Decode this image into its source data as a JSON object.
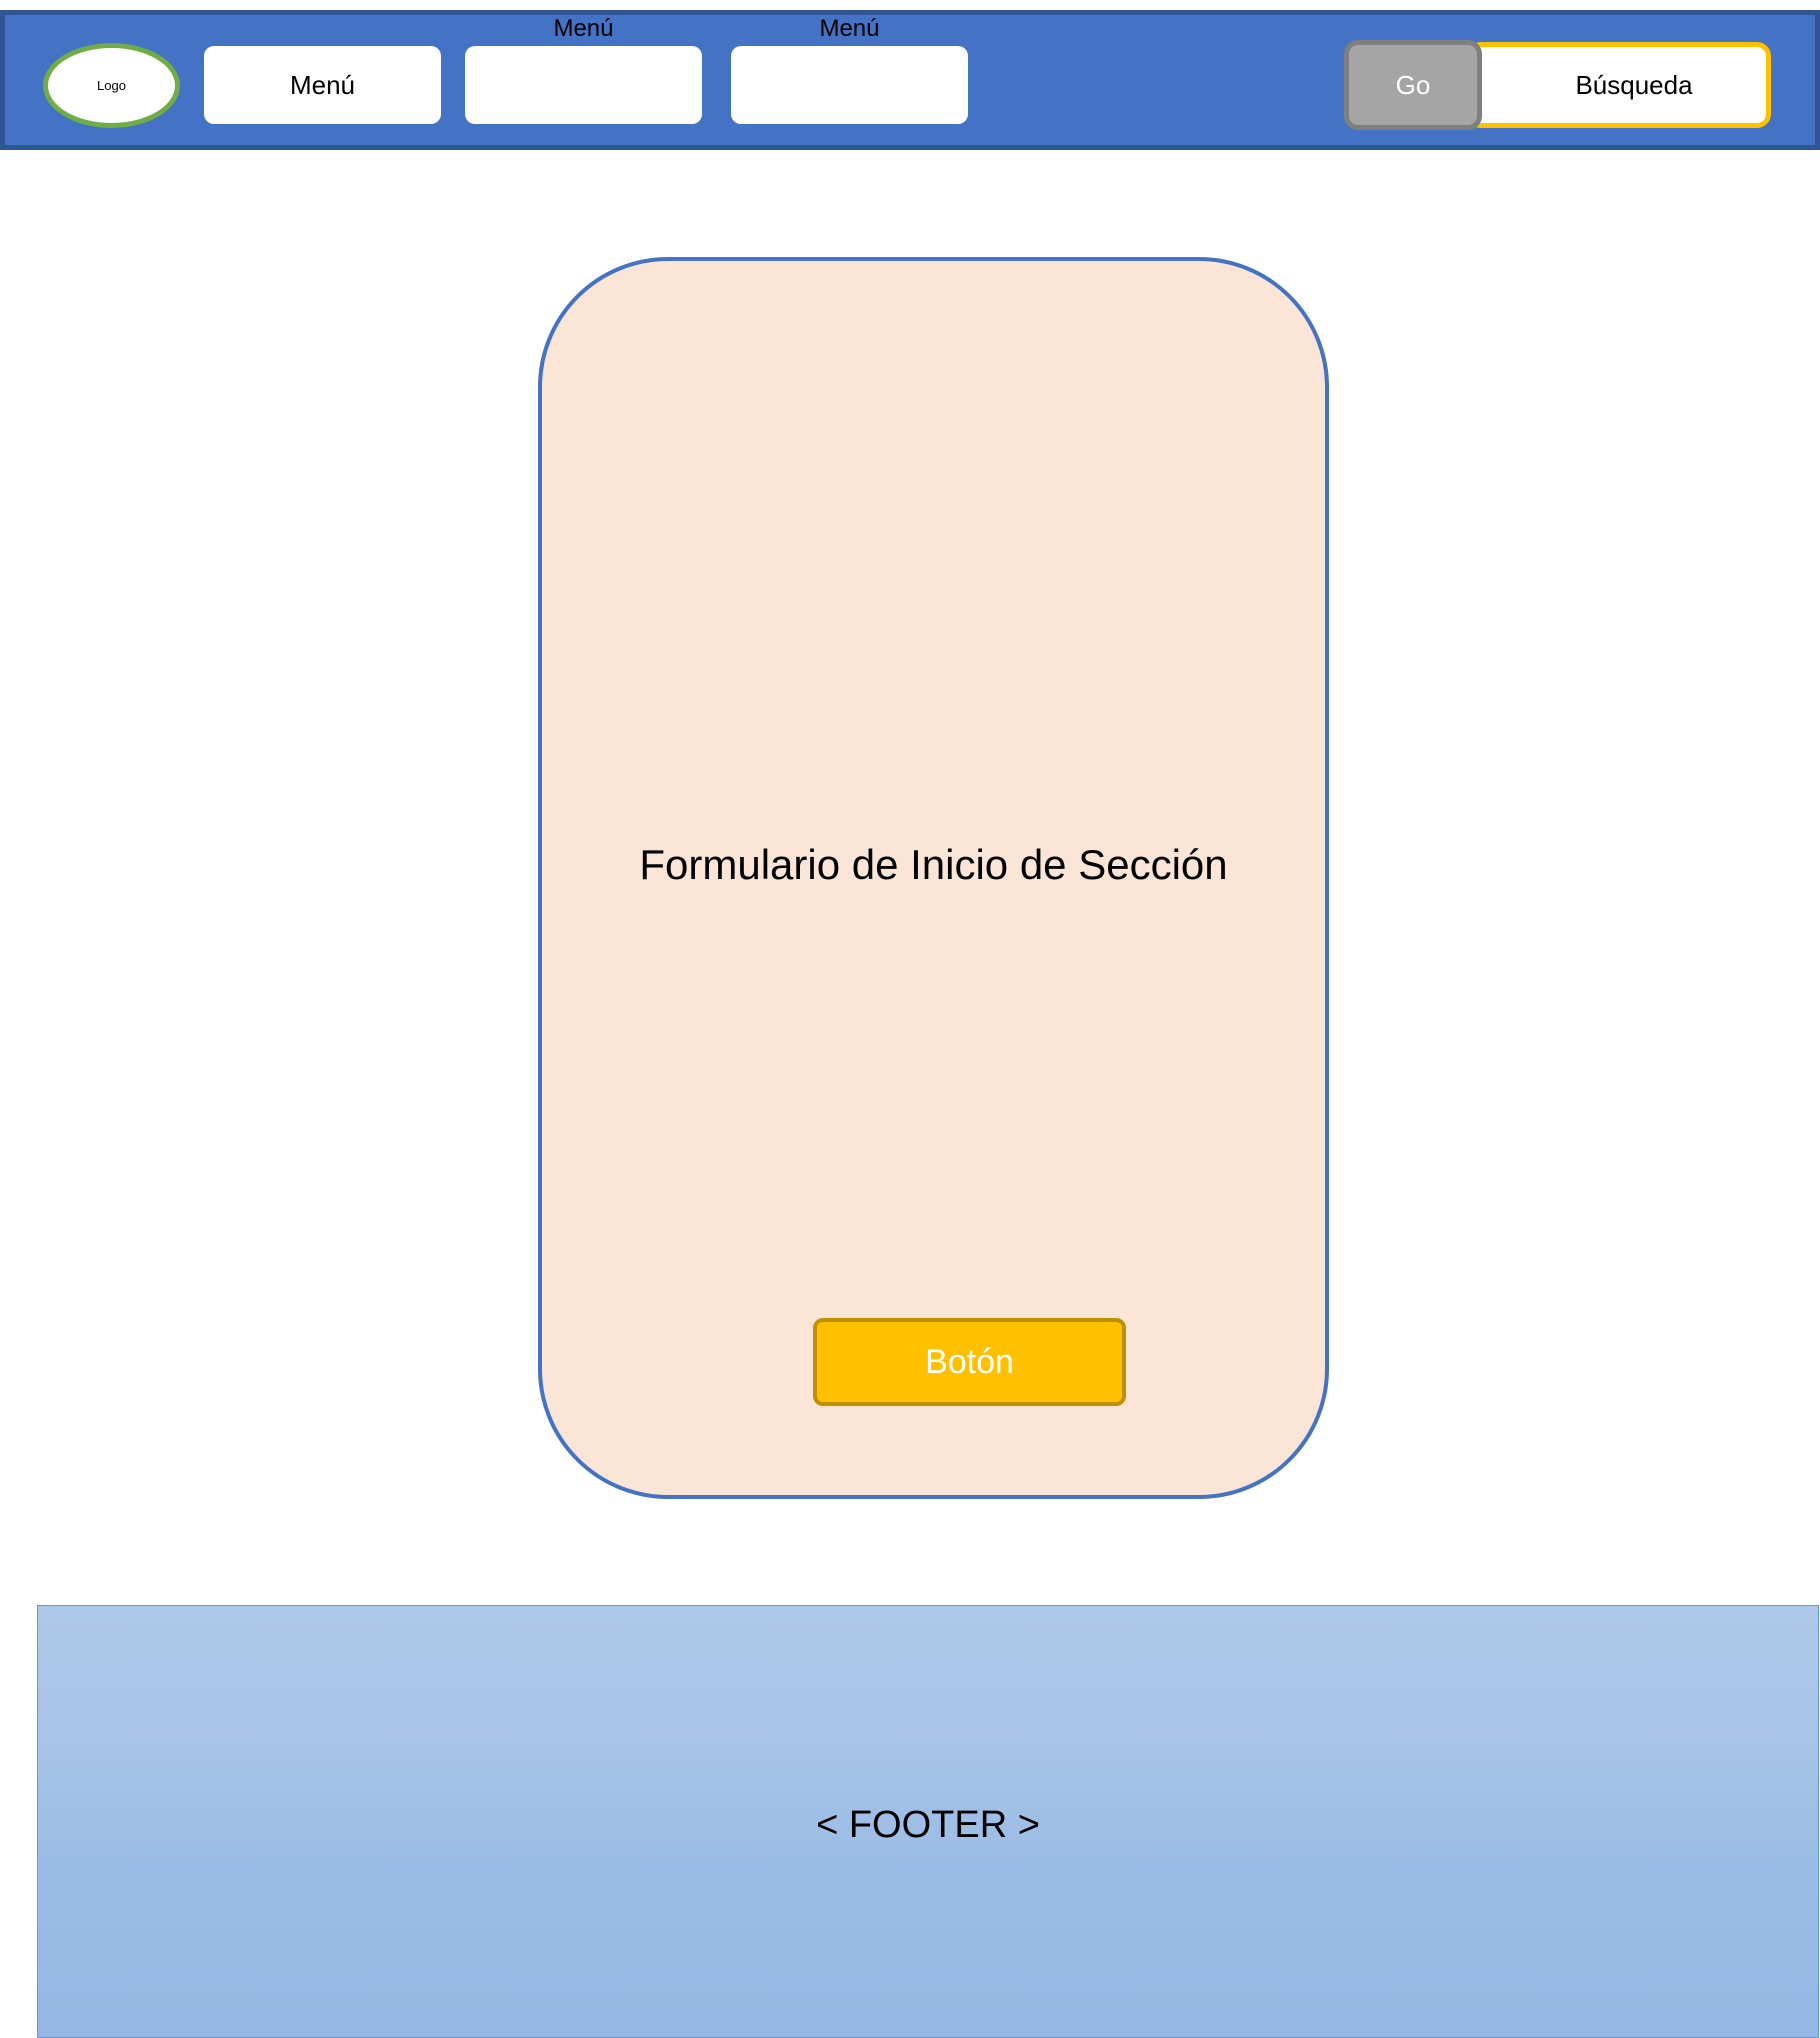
{
  "header": {
    "logo_text": "Logo",
    "menu_items": [
      {
        "label": "Menú"
      },
      {
        "label": ""
      },
      {
        "label": ""
      }
    ],
    "menu_captions": [
      "Menú",
      "Menú"
    ],
    "go_button_label": "Go",
    "search_text": "Búsqueda"
  },
  "main": {
    "form_title": "Formulario de Inicio de Sección",
    "button_label": "Botón"
  },
  "footer": {
    "label": "< FOOTER >"
  },
  "colors": {
    "navbar_bg": "#4472c4",
    "navbar_border": "#2f5597",
    "logo_border": "#70ad47",
    "search_border": "#ffc000",
    "go_button_bg": "#a5a5a5",
    "form_bg": "#fbe5d6",
    "form_border": "#4472c4",
    "form_button_bg": "#ffc000",
    "footer_bg": "#9bbce6"
  }
}
